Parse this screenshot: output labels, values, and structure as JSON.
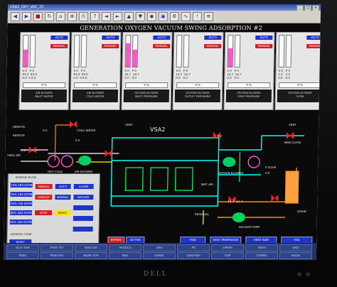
{
  "window": {
    "title": "VSA2_OXY_VAC_72"
  },
  "main_title": "GENERATION OXYGEN VACUUM SWING ADSORPTION #2",
  "controllers": [
    {
      "auto": "AUTO",
      "manual": "MANUAL",
      "nums": "S 0   P 0\n83.0  83.0\n0.0  S 0.0",
      "pct": "0 %",
      "title": "AIR BLOWER\nINLET WATER",
      "fills": [
        0.55,
        0.0
      ]
    },
    {
      "auto": "AUTO",
      "manual": "MANUAL",
      "nums": "S 0   P 0\n83.0  83.0\n0.0  S 0.0",
      "pct": "0 %",
      "title": "AIR BLOWER\nCOLD WATER",
      "fills": [
        0.0,
        0.0
      ]
    },
    {
      "auto": "AUTO",
      "manual": "MANUAL",
      "nums": "S 0   P 0\n14.7  14.7\n0.0   0.0",
      "pct": "0 %",
      "title": "OXYGEN BLOWER\nINLET PRESSURE",
      "fills": [
        0.75,
        0.55
      ]
    },
    {
      "auto": "AUTO",
      "manual": "MANUAL",
      "nums": "S 0   P 0\n14.7  14.7\n0.0   0.0",
      "pct": "0 %",
      "title": "OXYGEN BLOWER\nOUTLET PRESSURE",
      "fills": [
        0.0,
        0.0
      ]
    },
    {
      "auto": "AUTO",
      "manual": "MANUAL",
      "nums": "S 0   P 0\n14.7  14.7\n0.0   0.0",
      "pct": "0 %",
      "title": "OXYGEN BLOWER\nVENT PRESSURE",
      "fills": [
        0.6,
        0.0
      ]
    },
    {
      "auto": "AUTO",
      "manual": "MANUAL",
      "nums": "S 0   P 0\n1.0   1.0\n0.0   0.0",
      "pct": "0 %",
      "title": "OXYGEN BLOWER\nFLOW",
      "fills": [
        0.0,
        0.0
      ]
    }
  ],
  "process": {
    "vsa_label": "VSA2",
    "feed_air": "FEED AIR",
    "remote1": "REMOTE",
    "remote2": "REMOTE",
    "cold_water": "COLD WATER",
    "hot_cold": "HOT COLD",
    "air_blower": "AIR BLOWER",
    "vent1": "VENT",
    "vent2": "VENT",
    "o2_blower": "OXYGEN BLOWER",
    "inst_air": "INST AIR",
    "residual": "RESIDUAL",
    "vacuum_pump": "VACUUM PUMP",
    "man_close": "MAN CLOSE",
    "drain": "DRAIN",
    "v1": "76.2",
    "v2": "60.0",
    "v3": "0.0",
    "v4": "0.0",
    "v5": "0.0",
    "v6": "14.7",
    "v7": "14.7",
    "v8": "0.0",
    "v9": "0 SCFM"
  },
  "left_panel": {
    "header": "RESIDUE BLOW",
    "flows": [
      "74%  183 SCFM",
      "76%  183 SCFM",
      "76%  740 SCFM",
      "86%  183 SCFM",
      "65%  183 SCFM"
    ],
    "manual": "MANUAL",
    "auto": "AUTO",
    "startup": "STARTUP",
    "normal": "NORMAL",
    "stop": "STOP",
    "reset": "RESET",
    "alarm": "ALARM",
    "restart": "RESTART",
    "bottom": "AVERAGE FLOW",
    "reset_btn": "RESET"
  },
  "bottom_buttons": [
    "BYPASS",
    "ACTIVE",
    "FWD",
    "VENT PERMISSIVE",
    "VENT RAM",
    "VSA"
  ],
  "taskbar": [
    "BLST OVR",
    "PRIM TST",
    "RAW DAT",
    "PRODCS",
    "DRS",
    "PS",
    "OPERS",
    "TMOS",
    "UNIT",
    "PRES",
    "PRIM REG",
    "BLWR OVR",
    "ENG",
    "OVRNT",
    "DRNTRAP",
    "TRIP",
    "COMMS",
    "MODE"
  ],
  "brand": "DELL"
}
